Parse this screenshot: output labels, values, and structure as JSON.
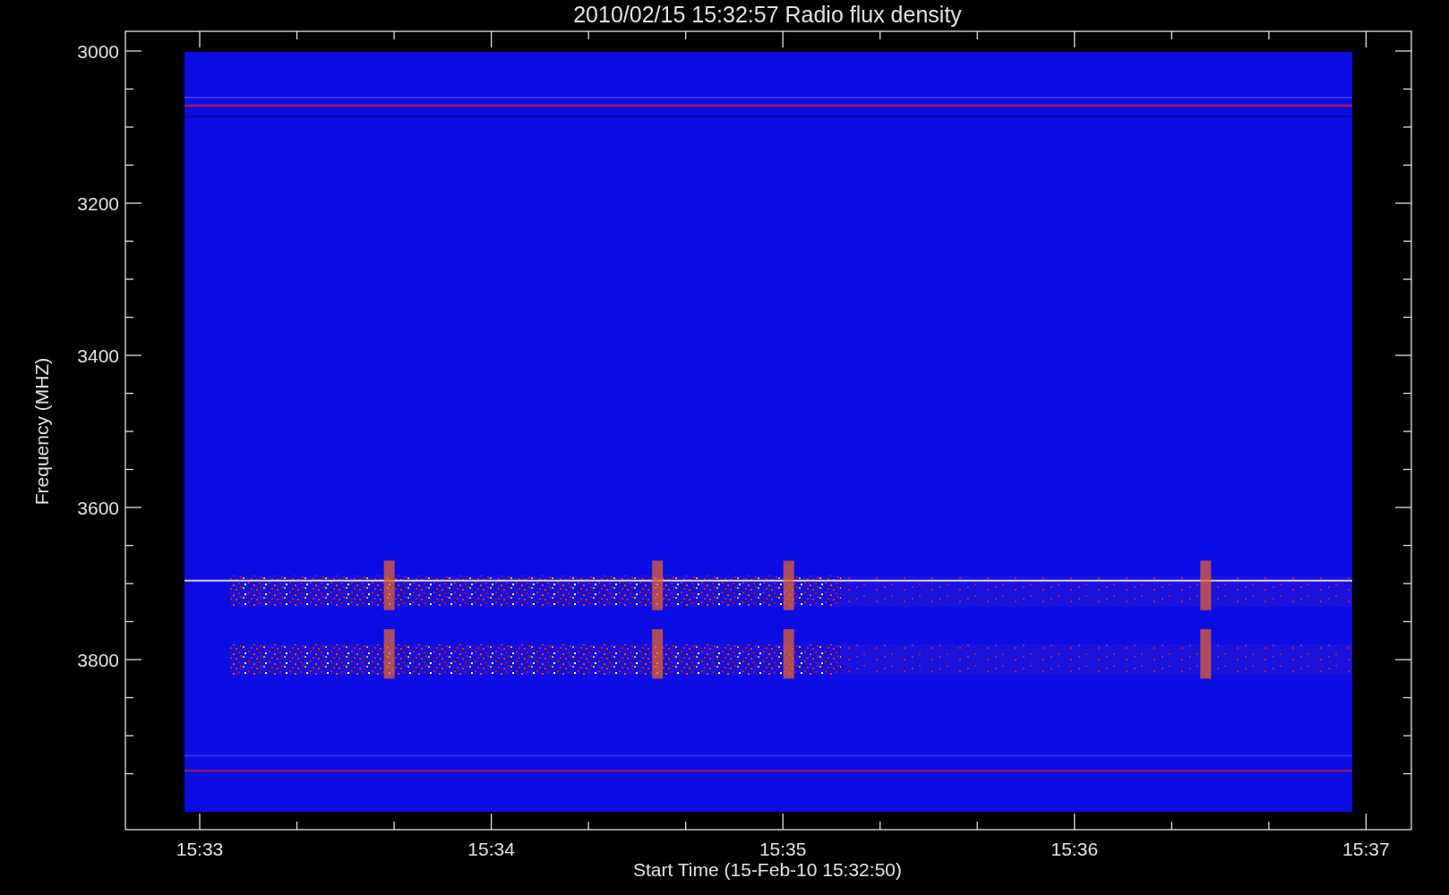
{
  "title": "2010/02/15 15:32:57 Radio flux density",
  "x_axis": {
    "label": "Start Time (15-Feb-10 15:32:50)",
    "ticks": [
      "15:33",
      "15:34",
      "15:35",
      "15:36",
      "15:37"
    ]
  },
  "y_axis": {
    "label": "Frequency (MHZ)",
    "ticks": [
      "3000",
      "3200",
      "3400",
      "3600",
      "3800"
    ]
  }
}
